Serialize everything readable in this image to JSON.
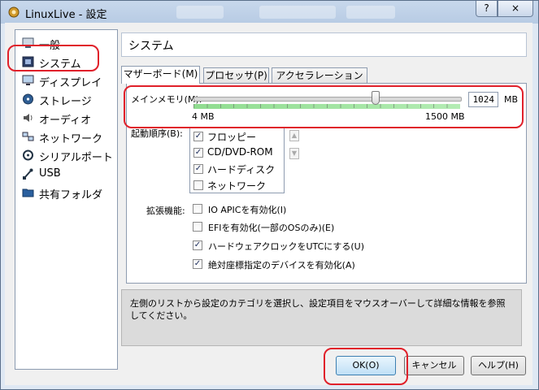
{
  "window": {
    "title": "LinuxLive - 設定",
    "help_button": "?",
    "close_button": "×"
  },
  "sidebar": {
    "items": [
      {
        "label": "一般",
        "icon": "general-icon"
      },
      {
        "label": "システム",
        "icon": "system-icon"
      },
      {
        "label": "ディスプレイ",
        "icon": "display-icon"
      },
      {
        "label": "ストレージ",
        "icon": "storage-icon"
      },
      {
        "label": "オーディオ",
        "icon": "audio-icon"
      },
      {
        "label": "ネットワーク",
        "icon": "network-icon"
      },
      {
        "label": "シリアルポート",
        "icon": "serial-port-icon"
      },
      {
        "label": "USB",
        "icon": "usb-icon"
      },
      {
        "label": "共有フォルダ",
        "icon": "shared-folder-icon"
      }
    ],
    "selected": "システム"
  },
  "section_title": "システム",
  "tabs": [
    {
      "label": "マザーボード(M)",
      "active": true
    },
    {
      "label": "プロセッサ(P)",
      "active": false
    },
    {
      "label": "アクセラレーション(L)",
      "active": false
    }
  ],
  "memory": {
    "label": "メインメモリ(M):",
    "value": "1024",
    "unit": "MB",
    "min_label": "4 MB",
    "max_label": "1500 MB",
    "min": 4,
    "max": 1500,
    "current": 1024
  },
  "boot": {
    "label": "起動順序(B):",
    "items": [
      {
        "label": "フロッピー",
        "checked": true
      },
      {
        "label": "CD/DVD-ROM",
        "checked": true
      },
      {
        "label": "ハードディスク",
        "checked": true
      },
      {
        "label": "ネットワーク",
        "checked": false
      }
    ]
  },
  "features": {
    "label": "拡張機能:",
    "items": [
      {
        "label": "IO APICを有効化(I)",
        "checked": false
      },
      {
        "label": "EFIを有効化(一部のOSのみ)(E)",
        "checked": false
      },
      {
        "label": "ハードウェアクロックをUTCにする(U)",
        "checked": true
      },
      {
        "label": "絶対座標指定のデバイスを有効化(A)",
        "checked": true
      }
    ]
  },
  "description": "左側のリストから設定のカテゴリを選択し、設定項目をマウスオーバーして詳細な情報を参照してください。",
  "buttons": {
    "ok": "OK(O)",
    "cancel": "キャンセル",
    "help": "ヘルプ(H)"
  },
  "colors": {
    "highlight": "#e0202a",
    "slider_range": "#8fdc8f"
  }
}
